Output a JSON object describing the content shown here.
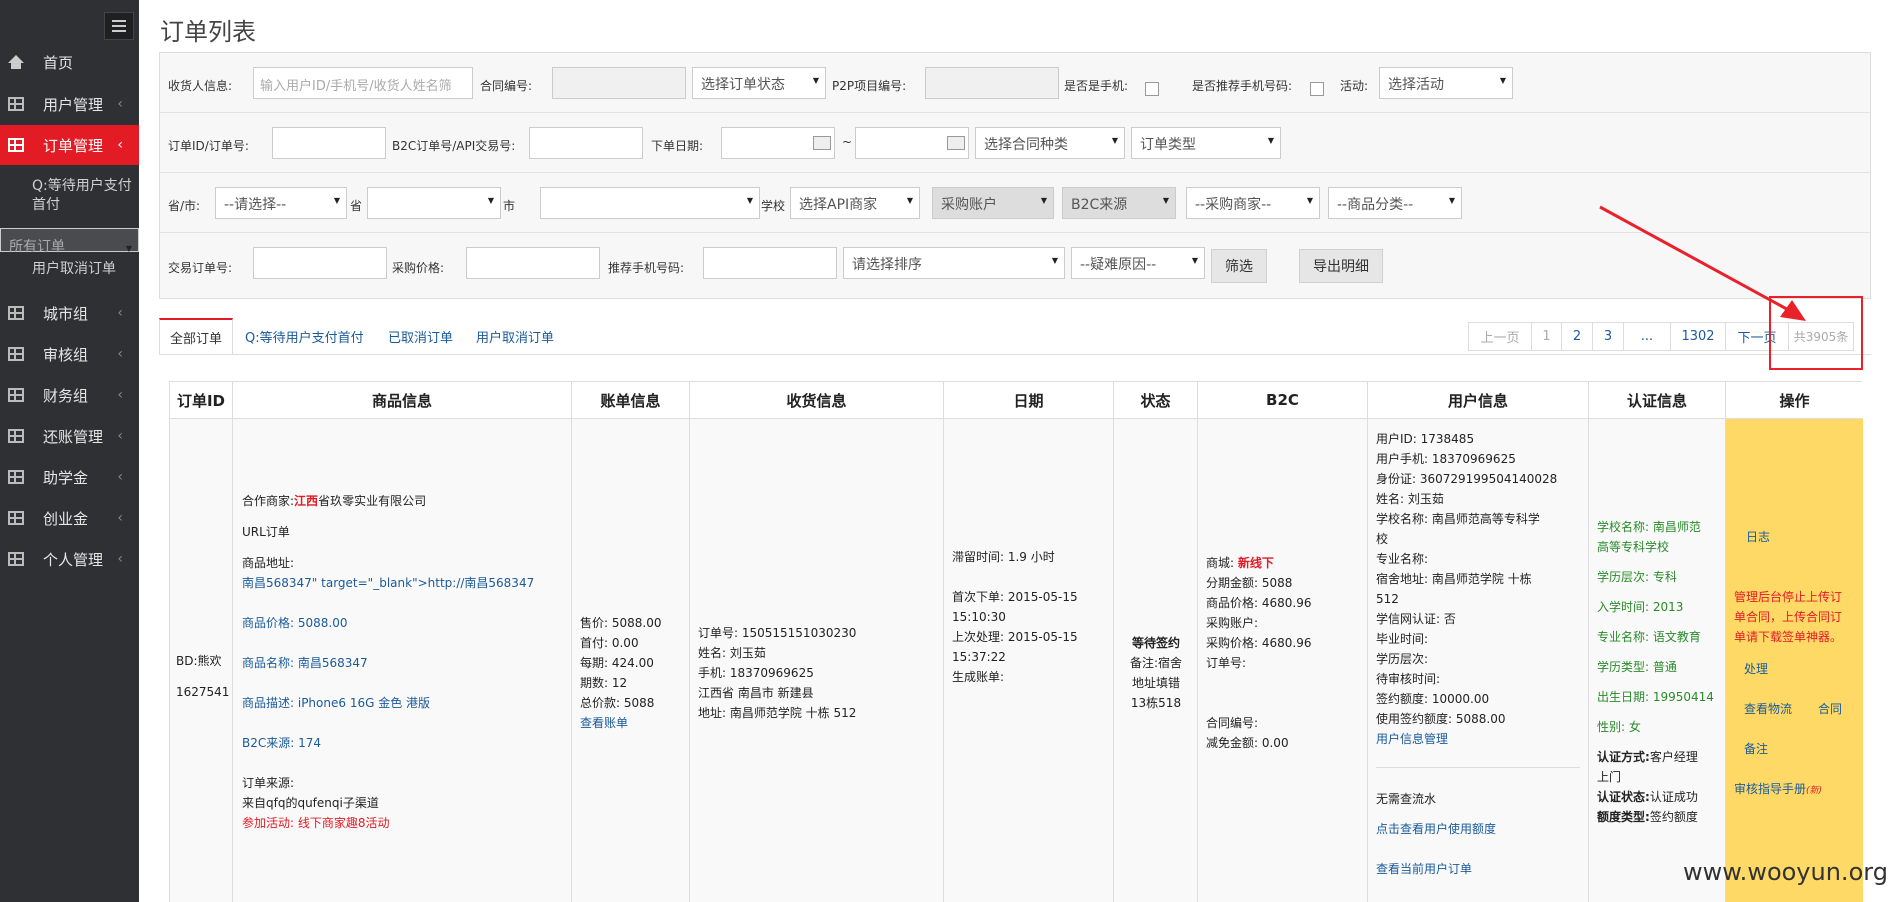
{
  "sidebar": {
    "items": [
      {
        "label": "首页"
      },
      {
        "label": "用户管理"
      },
      {
        "label": "订单管理"
      },
      {
        "label": "城市组"
      },
      {
        "label": "审核组"
      },
      {
        "label": "财务组"
      },
      {
        "label": "还账管理"
      },
      {
        "label": "助学金"
      },
      {
        "label": "创业金"
      },
      {
        "label": "个人管理"
      }
    ],
    "sub_items": [
      {
        "label_line1": "Q:等待用户支付",
        "label_line2": "首付"
      },
      {
        "label": "所有订单"
      },
      {
        "label": "用户取消订单"
      }
    ]
  },
  "page": {
    "title": "订单列表"
  },
  "filters": {
    "receiver_label": "收货人信息:",
    "receiver_placeholder": "输入用户ID/手机号/收货人姓名筛",
    "contract_label": "合同编号:",
    "order_status": "选择订单状态",
    "p2p_label": "P2P项目编号:",
    "is_mobile_label": "是否是手机:",
    "recommend_mobile_label": "是否推荐手机号码:",
    "activity_label": "活动:",
    "activity_select": "选择活动",
    "order_id_label": "订单ID/订单号:",
    "b2c_label": "B2C订单号/API交易号:",
    "order_date_label": "下单日期:",
    "tilde": "~",
    "contract_type": "选择合同种类",
    "order_type": "订单类型",
    "province_label": "省/市:",
    "province_select": "--请选择--",
    "province_suffix": "省",
    "city_suffix": "市",
    "school_suffix": "学校",
    "api_merchant": "选择API商家",
    "purchase_account": "采购账户",
    "b2c_source": "B2C来源",
    "purchase_merchant": "--采购商家--",
    "product_category": "--商品分类--",
    "trade_no_label": "交易订单号:",
    "purchase_price_label": "采购价格:",
    "recommend_phone_label": "推荐手机号码:",
    "sort_select": "请选择排序",
    "difficulty_select": "--疑难原因--",
    "filter_button": "筛选",
    "export_button": "导出明细"
  },
  "tabs": [
    {
      "label": "全部订单"
    },
    {
      "label": "Q:等待用户支付首付"
    },
    {
      "label": "已取消订单"
    },
    {
      "label": "用户取消订单"
    }
  ],
  "pagination": {
    "prev": "上一页",
    "pages": [
      "1",
      "2",
      "3",
      "...",
      "1302"
    ],
    "next": "下一页",
    "total": "共3905条"
  },
  "table": {
    "headers": [
      "订单ID",
      "商品信息",
      "账单信息",
      "收货信息",
      "日期",
      "状态",
      "B2C",
      "用户信息",
      "认证信息",
      "操作"
    ],
    "row": {
      "order_id": [
        "BD:熊欢",
        "1627541"
      ],
      "product": {
        "merchant_prefix": "合作商家:",
        "merchant_hl": "江西",
        "merchant_rest": "省玖零实业有限公司",
        "url_order": "URL订单",
        "addr_label": "商品地址:",
        "addr_value": "南昌568347\" target=\"_blank\">http://南昌568347",
        "price": "商品价格: 5088.00",
        "name": "商品名称: 南昌568347",
        "desc": "商品描述: iPhone6 16G 金色 港版",
        "b2c_source": "B2C来源: 174",
        "order_source_label": "订单来源:",
        "order_source_value": "来自qfq的qufenqi子渠道",
        "activity": "参加活动: 线下商家趣8活动"
      },
      "bill": [
        "售价: 5088.00",
        "首付: 0.00",
        "每期: 424.00",
        "期数: 12",
        "总价款: 5088"
      ],
      "bill_link": "查看账单",
      "shipping": [
        "订单号: 150515151030230",
        "姓名: 刘玉茹",
        "手机: 18370969625",
        "江西省   南昌市   新建县",
        "地址: 南昌师范学院 十栋 512"
      ],
      "dates": [
        "滞留时间: 1.9 小时",
        "",
        "首次下单: 2015-05-15",
        "15:10:30",
        "上次处理: 2015-05-15",
        "15:37:22",
        "生成账单:"
      ],
      "status": {
        "main": "等待签约",
        "note1": "备注:宿舍",
        "note2": "地址填错",
        "note3": "13栋518"
      },
      "b2c": {
        "mall_label": "商城:",
        "mall_value": "新线下",
        "installment": "分期金额: 5088",
        "product_price": "商品价格: 4680.96",
        "purchase_account": "采购账户:",
        "purchase_price": "采购价格: 4680.96",
        "order_no": "订单号:",
        "contract_no": "合同编号:",
        "waived": "减免金额: 0.00"
      },
      "user": [
        "用户ID: 1738485",
        "用户手机: 18370969625",
        "身份证: 360729199504140028",
        "姓名: 刘玉茹",
        "学校名称: 南昌师范高等专科学",
        "校",
        "专业名称:",
        "宿舍地址: 南昌师范学院 十栋",
        "512",
        "学信网认证: 否",
        "毕业时间:",
        "学历层次:",
        "待审核时间:",
        "签约额度: 10000.00",
        "使用签约额度: 5088.00"
      ],
      "user_link1": "用户信息管理",
      "user_flow": "无需查流水",
      "user_link2": "点击查看用户使用额度",
      "user_link3": "查看当前用户订单",
      "auth": [
        "学校名称: 南昌师范",
        "高等专科学校",
        "学历层次: 专科",
        "入学时间: 2013",
        "专业名称: 语文教育",
        "学历类型: 普通",
        "出生日期: 19950414",
        "性别: 女"
      ],
      "auth_method_label": "认证方式:",
      "auth_method_value1": "客户经理",
      "auth_method_value2": "上门",
      "auth_status_label": "认证状态:",
      "auth_status_value": "认证成功",
      "quota_type_label": "额度类型:",
      "quota_type_value": "签约额度",
      "ops": {
        "log": "日志",
        "warn1": "管理后台停止上传订",
        "warn2": "单合同，上传合同订",
        "warn3": "单请下载签单神器。",
        "process": "处理",
        "logistics": "查看物流",
        "contract": "合同",
        "remark": "备注",
        "guide": "审核指导手册",
        "guide_tag": "(新)"
      }
    }
  },
  "watermark": "www.wooyun.org",
  "colors": {
    "accent": "#e21b25",
    "sidebar": "#2f3033",
    "link": "#1a5a9a",
    "ops_bg": "#ffd966"
  }
}
